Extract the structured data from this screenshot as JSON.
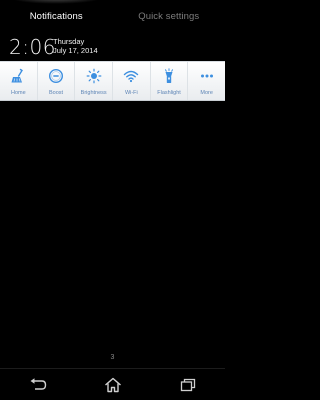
{
  "tabs": [
    {
      "label": "Notifications",
      "active": true
    },
    {
      "label": "Quick settings",
      "active": false
    }
  ],
  "clock": {
    "time": "2:06",
    "day": "Thursday",
    "date": "July 17, 2014"
  },
  "quick_settings": [
    {
      "label": "Home",
      "icon": "broom-icon"
    },
    {
      "label": "Boost",
      "icon": "boost-icon"
    },
    {
      "label": "Brightness",
      "icon": "brightness-icon"
    },
    {
      "label": "Wi-Fi",
      "icon": "wifi-icon"
    },
    {
      "label": "Flashlight",
      "icon": "flashlight-icon"
    },
    {
      "label": "More",
      "icon": "more-icon"
    }
  ],
  "page_indicator": "3",
  "colors": {
    "accent": "#3d8fe0",
    "panel_bg": "#ffffff",
    "label_color": "#5d84b5"
  },
  "navbar": [
    {
      "icon": "back-icon"
    },
    {
      "icon": "home-icon"
    },
    {
      "icon": "recent-apps-icon"
    }
  ]
}
